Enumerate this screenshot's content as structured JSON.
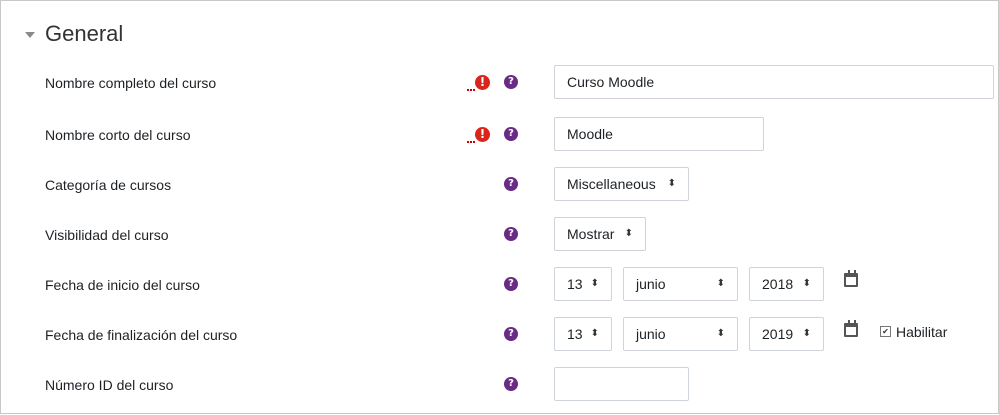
{
  "section": {
    "title": "General"
  },
  "fields": {
    "fullname": {
      "label": "Nombre completo del curso",
      "value": "Curso Moodle"
    },
    "shortname": {
      "label": "Nombre corto del curso",
      "value": "Moodle"
    },
    "category": {
      "label": "Categoría de cursos",
      "selected": "Miscellaneous"
    },
    "visibility": {
      "label": "Visibilidad del curso",
      "selected": "Mostrar"
    },
    "startdate": {
      "label": "Fecha de inicio del curso",
      "day": "13",
      "month": "junio",
      "year": "2018"
    },
    "enddate": {
      "label": "Fecha de finalización del curso",
      "day": "13",
      "month": "junio",
      "year": "2019",
      "enable_label": "Habilitar",
      "enabled": true
    },
    "idnumber": {
      "label": "Número ID del curso",
      "value": ""
    }
  },
  "icons": {
    "required": "required-icon",
    "help": "help-icon",
    "calendar": "calendar-icon",
    "select_arrows": "updown-arrows-icon"
  },
  "colors": {
    "required": "#d9251c",
    "help": "#6a2b84",
    "border": "#ced4da"
  }
}
